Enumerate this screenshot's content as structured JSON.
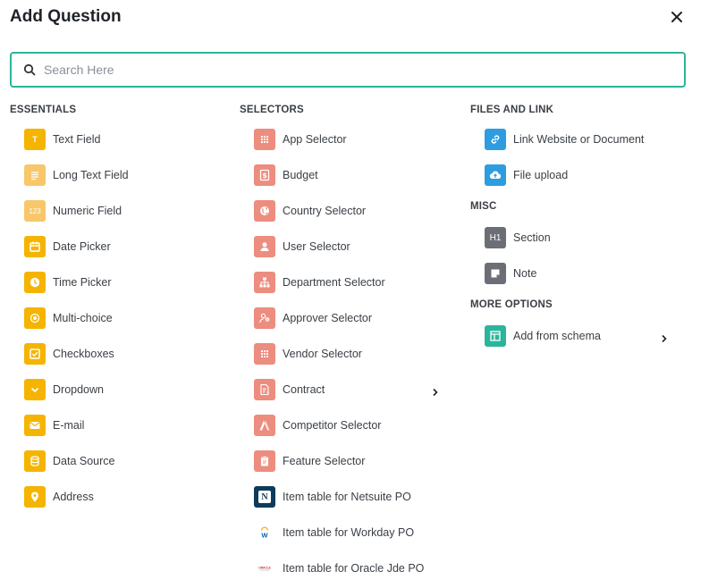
{
  "dialog": {
    "title": "Add Question",
    "search_placeholder": "Search Here"
  },
  "essentials": {
    "heading": "ESSENTIALS",
    "items": [
      {
        "label": "Text Field",
        "icon": "text-icon"
      },
      {
        "label": "Long Text Field",
        "icon": "long-text-icon"
      },
      {
        "label": "Numeric Field",
        "icon": "numeric-icon"
      },
      {
        "label": "Date Picker",
        "icon": "calendar-icon"
      },
      {
        "label": "Time Picker",
        "icon": "clock-icon"
      },
      {
        "label": "Multi-choice",
        "icon": "radio-icon"
      },
      {
        "label": "Checkboxes",
        "icon": "checkbox-icon"
      },
      {
        "label": "Dropdown",
        "icon": "chevron-down-icon"
      },
      {
        "label": "E-mail",
        "icon": "mail-icon"
      },
      {
        "label": "Data Source",
        "icon": "database-icon"
      },
      {
        "label": "Address",
        "icon": "location-pin-icon"
      }
    ]
  },
  "selectors": {
    "heading": "SELECTORS",
    "items": [
      {
        "label": "App Selector",
        "icon": "grid-icon"
      },
      {
        "label": "Budget",
        "icon": "dollar-icon"
      },
      {
        "label": "Country Selector",
        "icon": "globe-icon"
      },
      {
        "label": "User Selector",
        "icon": "user-icon"
      },
      {
        "label": "Department Selector",
        "icon": "org-chart-icon"
      },
      {
        "label": "Approver Selector",
        "icon": "approver-icon"
      },
      {
        "label": "Vendor Selector",
        "icon": "grid-icon"
      },
      {
        "label": "Contract",
        "icon": "contract-icon"
      },
      {
        "label": "Competitor Selector",
        "icon": "competitor-icon"
      },
      {
        "label": "Feature Selector",
        "icon": "clipboard-icon"
      },
      {
        "label": "Item table for Netsuite PO",
        "icon": "netsuite-logo-icon"
      },
      {
        "label": "Item table for Workday PO",
        "icon": "workday-logo-icon"
      },
      {
        "label": "Item table for Oracle Jde PO",
        "icon": "oracle-logo-icon"
      }
    ],
    "logo_text": {
      "netsuite": "N",
      "workday": "W",
      "oracle": "ORACLE"
    }
  },
  "files_and_link": {
    "heading": "FILES AND LINK",
    "items": [
      {
        "label": "Link Website or Document",
        "icon": "link-icon"
      },
      {
        "label": "File upload",
        "icon": "cloud-upload-icon"
      }
    ]
  },
  "misc": {
    "heading": "MISC",
    "items": [
      {
        "label": "Section",
        "icon": "heading-icon",
        "glyph": "H1"
      },
      {
        "label": "Note",
        "icon": "note-icon"
      }
    ]
  },
  "more_options": {
    "heading": "MORE OPTIONS",
    "items": [
      {
        "label": "Add from schema",
        "icon": "schema-icon"
      }
    ]
  },
  "colors": {
    "accent": "#2bb59a",
    "essentials_icon": "#f5b400",
    "essentials_icon_light": "#f7c76a",
    "selectors_icon": "#ec8d7f",
    "files_icon": "#2d9de0",
    "misc_icon": "#6b6f75"
  }
}
